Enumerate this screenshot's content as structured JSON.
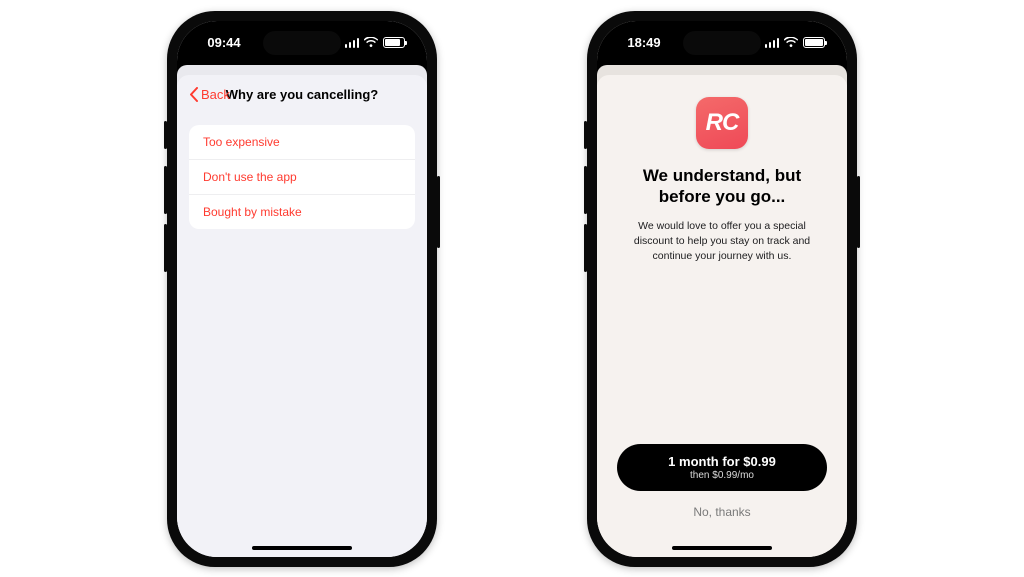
{
  "left": {
    "status_time": "09:44",
    "back_label": "Back",
    "title": "Why are you cancelling?",
    "reasons": [
      "Too expensive",
      "Don't use the app",
      "Bought by mistake"
    ]
  },
  "right": {
    "status_time": "18:49",
    "app_icon_text": "RC",
    "title": "We understand, but before you go...",
    "body": "We would love to offer you a special discount to help you stay on track and continue your journey with us.",
    "cta_main": "1 month for $0.99",
    "cta_sub": "then $0.99/mo",
    "decline": "No, thanks"
  },
  "colors": {
    "ios_red": "#ff3b30",
    "sheet_grey": "#f2f2f7",
    "cream": "#f6f2ef",
    "app_icon_gradient_from": "#f46a6a",
    "app_icon_gradient_to": "#ef4957"
  }
}
